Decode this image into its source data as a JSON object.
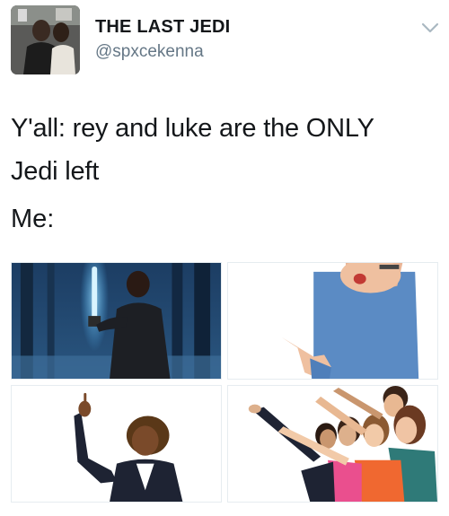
{
  "tweet": {
    "display_name": "THE LAST JEDI",
    "handle": "@spxcekenna",
    "text_lines": [
      "Y'all: rey and luke are the ONLY",
      "Jedi left"
    ],
    "reply_label": "Me:",
    "menu_icon": "chevron-down-icon"
  },
  "media": [
    {
      "name": "media-jedi-lightsaber"
    },
    {
      "name": "media-man-pointing-at-self"
    },
    {
      "name": "media-woman-pointing-up"
    },
    {
      "name": "media-group-pointing"
    }
  ],
  "colors": {
    "text": "#14171a",
    "secondary": "#657786",
    "chevron": "#aab8c2",
    "saber": "#4db8ff"
  }
}
